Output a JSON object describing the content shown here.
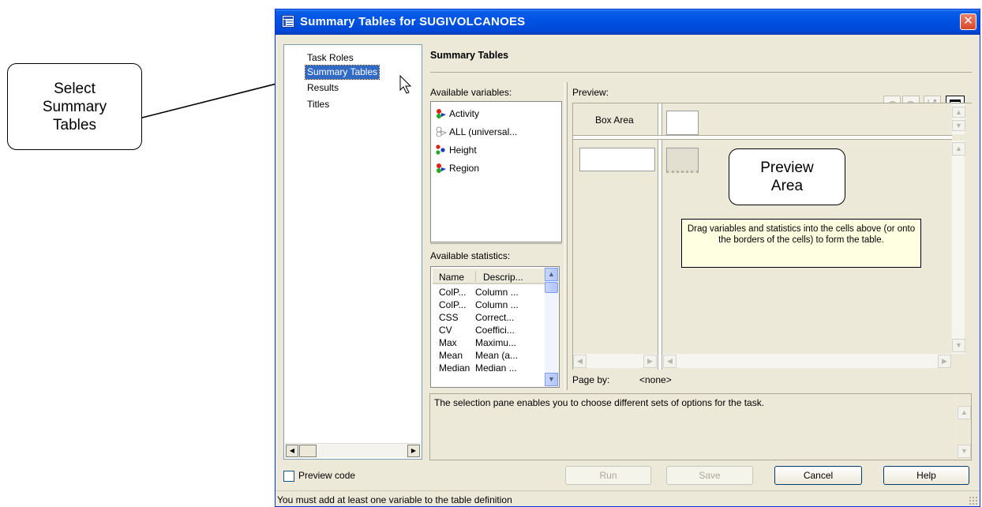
{
  "annotations": {
    "select_label": "Select\nSummary\nTables",
    "preview_label": "Preview\nArea"
  },
  "window": {
    "title": "Summary Tables for SUGIVOLCANOES",
    "close_glyph": "✕"
  },
  "nav": {
    "items": [
      {
        "label": "Task Roles",
        "selected": false
      },
      {
        "label": "Summary Tables",
        "selected": true
      },
      {
        "label": "Results",
        "selected": false
      },
      {
        "label": "Titles",
        "selected": false
      }
    ]
  },
  "main": {
    "heading": "Summary Tables",
    "available_variables_label": "Available variables:",
    "variables": [
      {
        "label": "Activity",
        "icon": "category-variable-icon"
      },
      {
        "label": "ALL (universal...",
        "icon": "universal-class-icon"
      },
      {
        "label": "Height",
        "icon": "analysis-variable-icon"
      },
      {
        "label": "Region",
        "icon": "category-variable-icon"
      }
    ],
    "available_statistics_label": "Available statistics:",
    "statistics_headers": [
      "Name",
      "Descrip..."
    ],
    "statistics": [
      [
        "ColP...",
        "Column ..."
      ],
      [
        "ColP...",
        "Column ..."
      ],
      [
        "CSS",
        "Correct..."
      ],
      [
        "CV",
        "Coeffici..."
      ],
      [
        "Max",
        "Maximu..."
      ],
      [
        "Mean",
        "Mean (a..."
      ],
      [
        "Median",
        "Median ..."
      ]
    ],
    "preview_label": "Preview:",
    "box_area_label": "Box Area",
    "hint_text": "Drag variables and statistics into the cells above (or onto the borders of the cells) to form the table.",
    "page_by_label": "Page by:",
    "page_by_value": "<none>",
    "description": "The selection pane enables you to choose different sets of options for the task."
  },
  "footer": {
    "preview_code_label": "Preview code",
    "run_label": "Run",
    "save_label": "Save",
    "cancel_label": "Cancel",
    "help_label": "Help"
  },
  "statusbar": {
    "text": "You must add at least one variable to the table definition"
  },
  "colors": {
    "title_bar": "#0054e3",
    "dialog_bg": "#ece9d8",
    "selection": "#316ac5",
    "hint_bg": "#ffffe1"
  }
}
